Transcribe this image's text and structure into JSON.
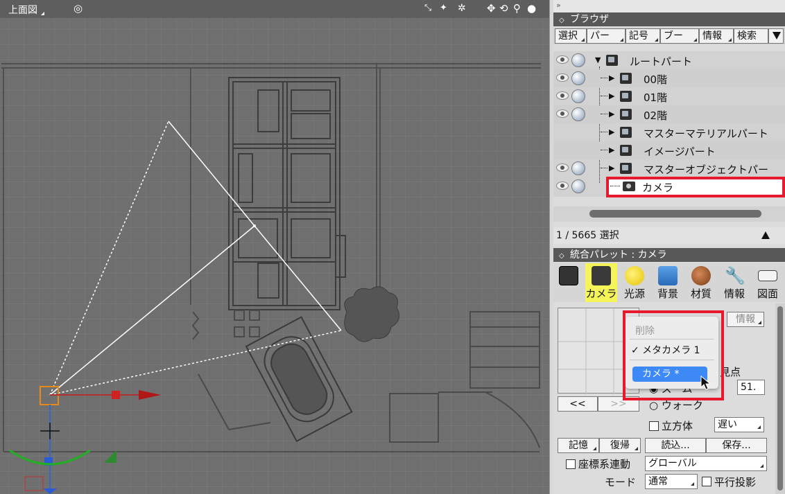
{
  "viewport": {
    "view_name": "上面図",
    "icons": [
      "target-icon",
      "fit-view-icon",
      "zoom-extents-icon",
      "render-settings-icon",
      "pan-icon",
      "rotate-icon",
      "zoom-icon",
      "shading-icon"
    ]
  },
  "browser": {
    "top_strip": "»",
    "title": "ブラウザ",
    "tabs": [
      "選択",
      "パー",
      "記号",
      "ブー",
      "情報",
      "検索"
    ],
    "tree": [
      {
        "label": "ルートパート",
        "visible": true
      },
      {
        "label": "00階",
        "visible": true
      },
      {
        "label": "01階",
        "visible": true
      },
      {
        "label": "02階",
        "visible": true
      },
      {
        "label": "マスターマテリアルパート",
        "visible": false
      },
      {
        "label": "イメージパート",
        "visible": false
      },
      {
        "label": "マスターオブジェクトパー",
        "visible": true
      },
      {
        "label": "カメラ",
        "visible": true,
        "selected": true
      }
    ],
    "status": "1 / 5665 選択"
  },
  "palette": {
    "title": "統合パレット : カメラ",
    "tabs": [
      {
        "label": "",
        "icon": "object-icon"
      },
      {
        "label": "カメラ",
        "icon": "camera-icon",
        "active": true
      },
      {
        "label": "光源",
        "icon": "light-icon"
      },
      {
        "label": "背景",
        "icon": "background-icon"
      },
      {
        "label": "材質",
        "icon": "material-icon"
      },
      {
        "label": "情報",
        "icon": "info-wrench-icon"
      },
      {
        "label": "図面",
        "icon": "ruler-icon"
      }
    ],
    "info_button": "情報",
    "menu": {
      "delete": "削除",
      "meta_camera": "✓ メタカメラ 1",
      "camera_selected": "カメラ *"
    },
    "viewpoint_partial": "見点",
    "value_field": "51.",
    "zoom_radio_partial": "ズーム",
    "walk_radio": "ウォーク",
    "nav_prev": "<<",
    "nav_next": ">>",
    "cube_label": "立方体",
    "speed_value": "遅い",
    "memory_button": "記憶",
    "restore_button": "復帰",
    "load_button": "読込...",
    "save_button": "保存...",
    "coord_link_label": "座標系連動",
    "coord_value": "グローバル",
    "mode_label": "モード",
    "mode_value": "通常",
    "parallel_label": "平行投影"
  },
  "colors": {
    "highlight": "#e8192c",
    "selection": "#3d8af7",
    "active_tab": "#f5f55a"
  }
}
